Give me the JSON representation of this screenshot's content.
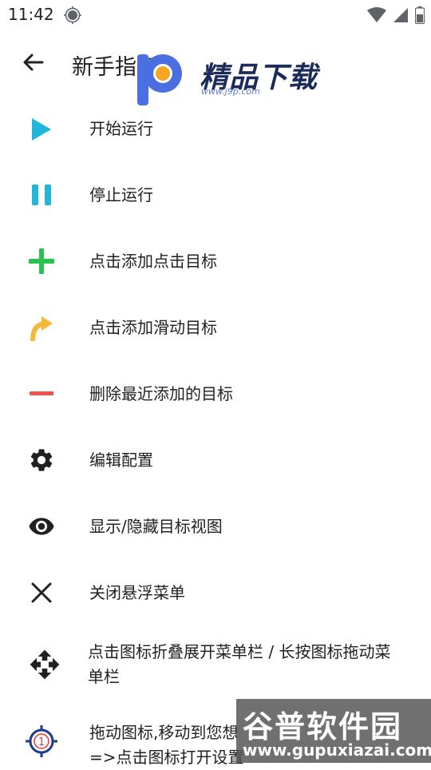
{
  "status": {
    "time": "11:42"
  },
  "app_bar": {
    "title": "新手指南"
  },
  "watermark_top": {
    "brand": "精品下载",
    "url": "www.j9p.com"
  },
  "items": [
    {
      "label": "开始运行",
      "icon": "play-icon",
      "color": "#1fb6d8"
    },
    {
      "label": "停止运行",
      "icon": "pause-icon",
      "color": "#1fb6d8"
    },
    {
      "label": "点击添加点击目标",
      "icon": "plus-icon",
      "color": "#2bc04f"
    },
    {
      "label": "点击添加滑动目标",
      "icon": "swipe-arrow-icon",
      "color": "#f5b83a"
    },
    {
      "label": "删除最近添加的目标",
      "icon": "minus-icon",
      "color": "#ef5350"
    },
    {
      "label": "编辑配置",
      "icon": "gear-icon",
      "color": "#212121"
    },
    {
      "label": "显示/隐藏目标视图",
      "icon": "eye-icon",
      "color": "#212121"
    },
    {
      "label": "关闭悬浮菜单",
      "icon": "close-icon",
      "color": "#212121"
    },
    {
      "label_line1": "点击图标折叠展开菜单栏 / 长按图标拖动菜",
      "label_line2": "单栏",
      "icon": "move-icon",
      "color": "#212121"
    },
    {
      "label_line1": "拖动图标,移动到您想",
      "label_line2": "=>点击图标打开设置",
      "icon": "target-icon",
      "color": "#1e3a8a",
      "target_number": "1"
    }
  ],
  "watermark_bottom": {
    "brand": "谷普软件园",
    "url": "www.gupuxiazai.com"
  }
}
